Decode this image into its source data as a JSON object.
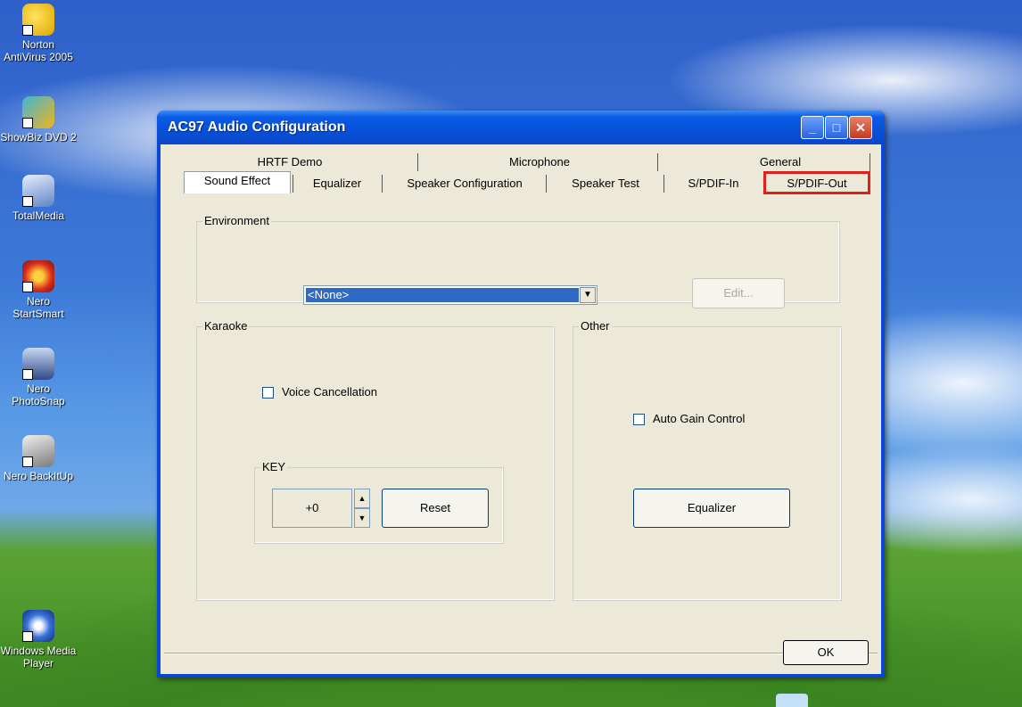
{
  "desktop": {
    "icons": [
      {
        "label": "Norton AntiVirus 2005",
        "icon": "norton-icon"
      },
      {
        "label": "ShowBiz DVD 2",
        "icon": "showbiz-dvd-icon"
      },
      {
        "label": "TotalMedia",
        "icon": "totalmedia-icon"
      },
      {
        "label": "Nero StartSmart",
        "icon": "nero-startsmart-icon"
      },
      {
        "label": "Nero PhotoSnap",
        "icon": "nero-photosnap-icon"
      },
      {
        "label": "Nero BackItUp",
        "icon": "nero-backitup-icon"
      },
      {
        "label": "Windows Media Player",
        "icon": "windows-media-player-icon"
      }
    ]
  },
  "window": {
    "title": "AC97 Audio Configuration",
    "controls": {
      "minimize": "_",
      "maximize": "□",
      "close": "✕"
    }
  },
  "tabs": {
    "row1": [
      "HRTF Demo",
      "Microphone",
      "General"
    ],
    "row2": [
      "Sound Effect",
      "Equalizer",
      "Speaker Configuration",
      "Speaker Test",
      "S/PDIF-In",
      "S/PDIF-Out"
    ],
    "selected": "Sound Effect",
    "highlighted": "S/PDIF-Out",
    "highlight_color": "#e0201b"
  },
  "environment": {
    "label": "Environment",
    "selected": "<None>",
    "edit_button": "Edit..."
  },
  "karaoke": {
    "label": "Karaoke",
    "voice_cancellation": "Voice Cancellation",
    "key_label": "KEY",
    "key_value": "+0",
    "reset_button": "Reset"
  },
  "other": {
    "label": "Other",
    "auto_gain": "Auto Gain Control",
    "equalizer_button": "Equalizer"
  },
  "footer": {
    "ok_button": "OK"
  }
}
